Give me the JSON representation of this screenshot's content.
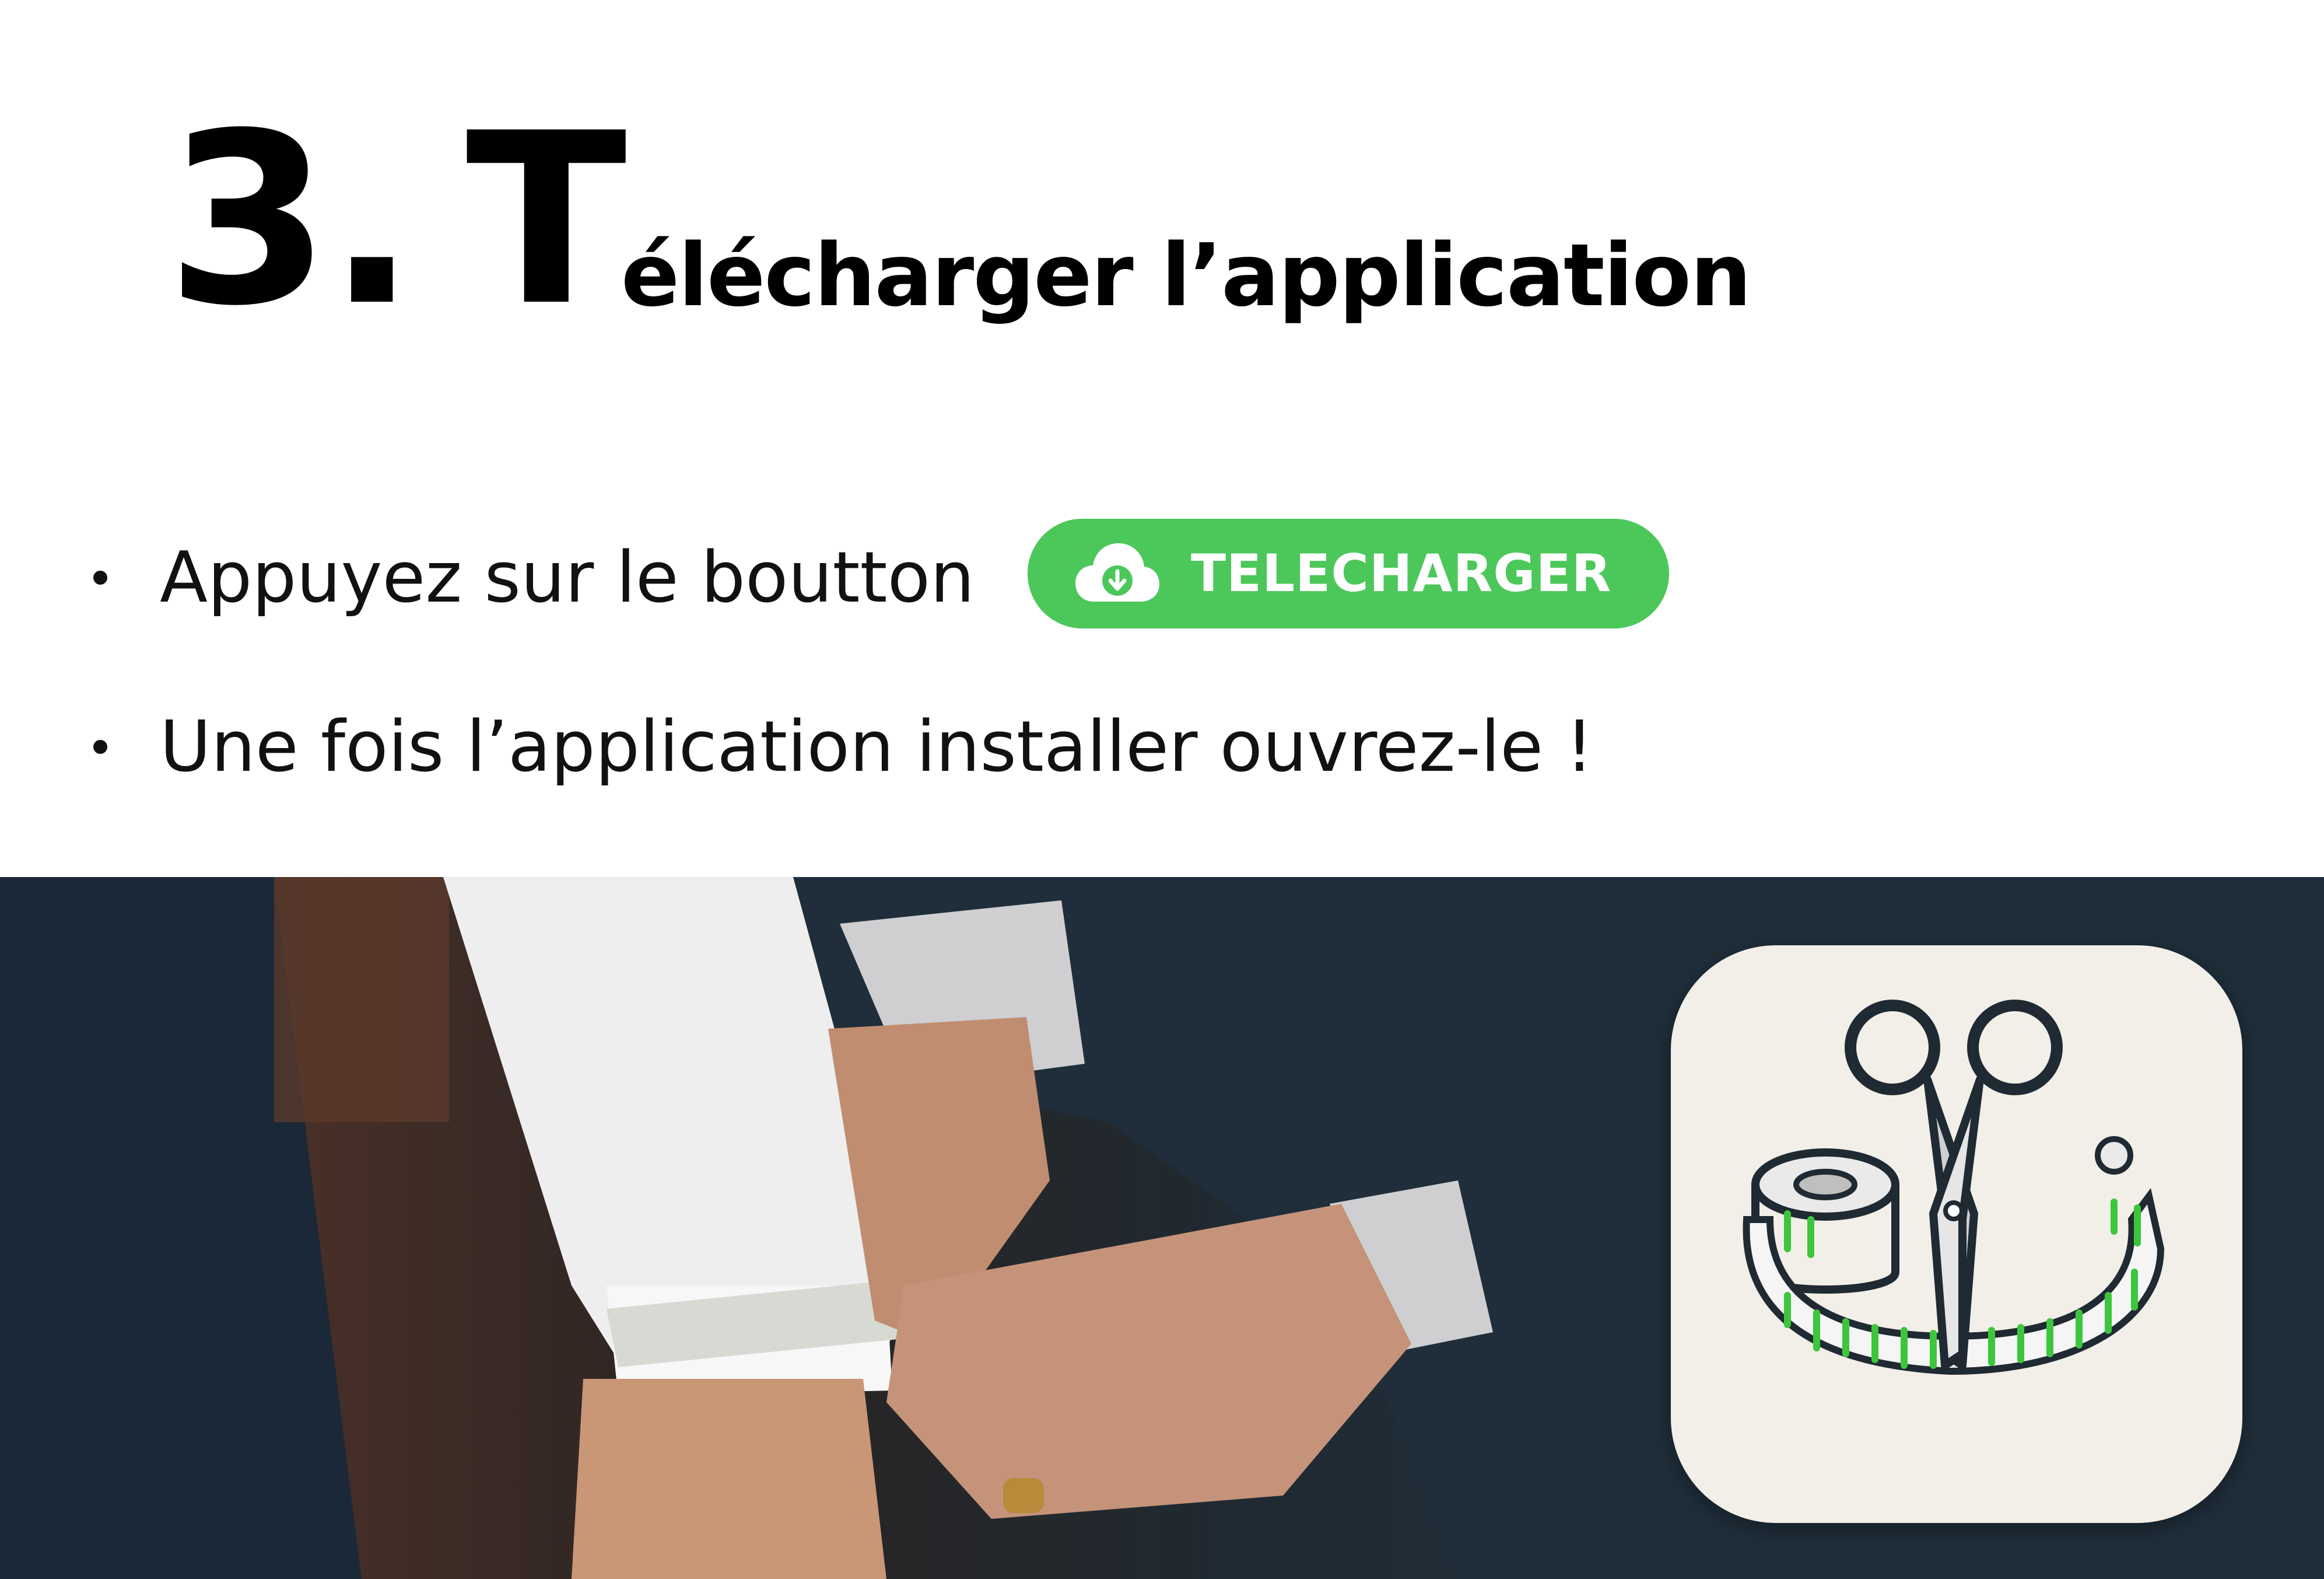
{
  "heading": {
    "number": "3.",
    "big_letter": "T",
    "rest": "élécharger l’application"
  },
  "steps": [
    {
      "text": "Appuyez sur le boutton"
    },
    {
      "text": "Une fois l’application installer ouvrez-le !"
    }
  ],
  "download_button": {
    "label": "TELECHARGER",
    "icon": "cloud-download-icon",
    "color": "#4cc75a"
  },
  "app_icon": {
    "icon": "scissors-measuring-tape-icon",
    "accent": "#3cc63c"
  }
}
